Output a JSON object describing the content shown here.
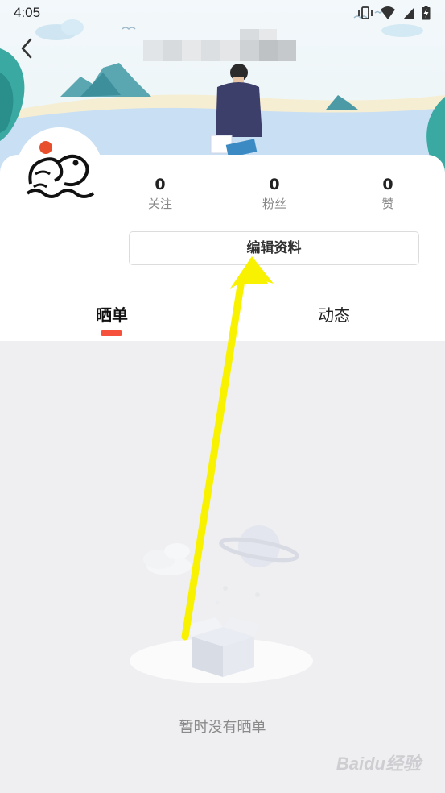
{
  "status_bar": {
    "time": "4:05",
    "icons": [
      "vibrate-icon",
      "wifi-icon",
      "signal-icon",
      "battery-charging-icon"
    ]
  },
  "header": {
    "back_icon": "chevron-left-icon"
  },
  "profile": {
    "stats": [
      {
        "value": "0",
        "label": "关注"
      },
      {
        "value": "0",
        "label": "粉丝"
      },
      {
        "value": "0",
        "label": "赞"
      }
    ],
    "edit_label": "编辑资料"
  },
  "tabs": [
    {
      "label": "晒单",
      "active": true
    },
    {
      "label": "动态",
      "active": false
    }
  ],
  "empty_state": {
    "text": "暂时没有晒单"
  },
  "watermark": "Baidu经验",
  "colors": {
    "accent": "#f5513c",
    "arrow": "#f8f200",
    "page_bg": "#efeff1"
  }
}
